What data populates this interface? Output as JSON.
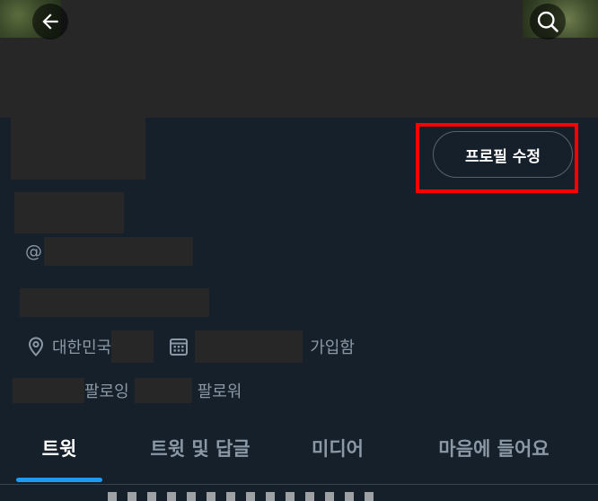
{
  "header": {
    "back_icon": "arrow-left-icon",
    "search_icon": "search-icon"
  },
  "profile": {
    "edit_button_label": "프로필 수정",
    "handle_prefix": "@",
    "location": "대한민국",
    "joined_suffix": "가입함",
    "following_label": "팔로잉",
    "followers_label": "팔로워"
  },
  "tabs": [
    {
      "label": "트윗",
      "active": true
    },
    {
      "label": "트윗 및 답글",
      "active": false
    },
    {
      "label": "미디어",
      "active": false
    },
    {
      "label": "마음에 들어요",
      "active": false
    }
  ],
  "colors": {
    "background": "#15202b",
    "accent": "#1d9bf0",
    "secondary_text": "#8b98a5",
    "highlight": "#ff0000"
  }
}
